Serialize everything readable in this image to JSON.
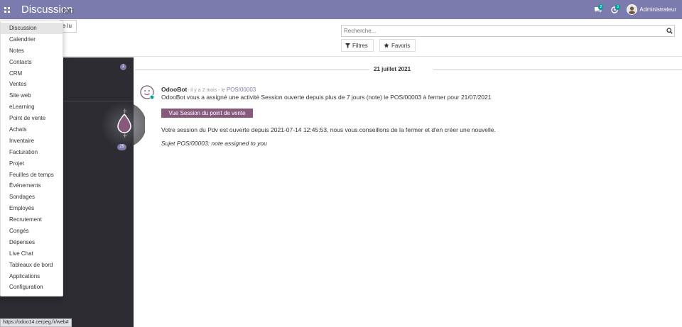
{
  "navbar": {
    "title": "Discussion",
    "messages_count": "2",
    "activities_count": "1",
    "user_name": "Administrateur",
    "accent": "#7c7bad"
  },
  "control_panel": {
    "title_partial": "ion",
    "mark_read_partial": "e lu",
    "search_placeholder": "Recherche...",
    "filters_label": "Filtres",
    "favorites_label": "Favoris"
  },
  "sidebar": {
    "badge_top": "1",
    "badge_bottom": "29"
  },
  "thread": {
    "date": "21 juillet 2021",
    "author": "OdooBot",
    "meta": "- il y a 2 mois - le",
    "record_link": "POS/00003",
    "body": "OdooBot vous a assigné une activité Session ouverte depuis plus de 7 jours (note) le POS/00003 à fermer pour 21/07/2021",
    "button_label": "Vue Session du point de vente",
    "paragraph": "Votre session du Pdv est ouverte depuis 2021-07-14 12:45:53, nous vous conseillons de la fermer et d'en créer une nouvelle.",
    "note": "Sujet POS/00003: note assigned to you",
    "button_color": "#875a7b"
  },
  "app_menu": {
    "items": [
      "Discussion",
      "Calendrier",
      "Notes",
      "Contacts",
      "CRM",
      "Ventes",
      "Site web",
      "eLearning",
      "Point de vente",
      "Achats",
      "Inventaire",
      "Facturation",
      "Projet",
      "Feuilles de temps",
      "Événements",
      "Sondages",
      "Employés",
      "Recrutement",
      "Congés",
      "Dépenses",
      "Live Chat",
      "Tableaux de bord",
      "Applications",
      "Configuration"
    ],
    "active": "Discussion"
  },
  "status_url": "https://odoo14.cerpeg.fr/web#"
}
